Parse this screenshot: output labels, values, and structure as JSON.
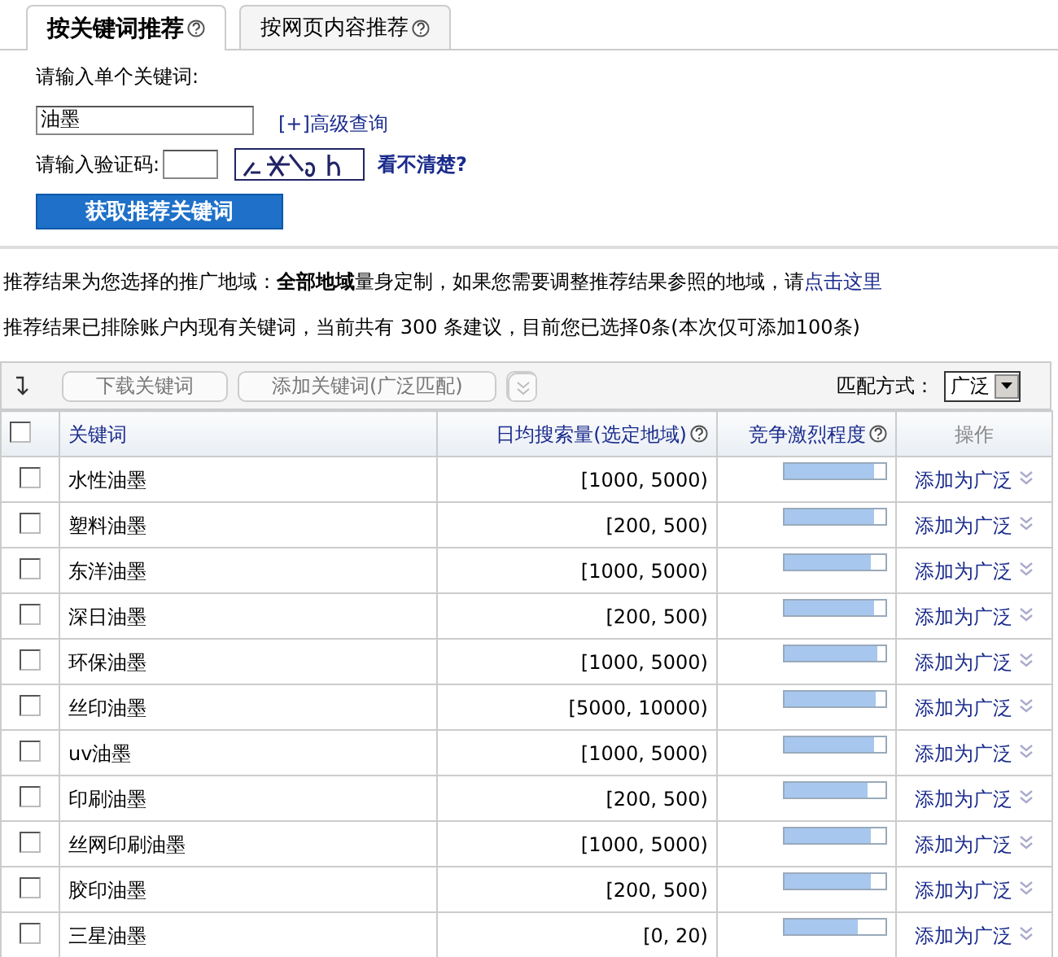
{
  "tabs": [
    {
      "label": "按关键词推荐",
      "selected": true
    },
    {
      "label": "按网页内容推荐",
      "selected": false
    }
  ],
  "form": {
    "keyword_label": "请输入单个关键词:",
    "keyword_value": "油墨",
    "advanced_link": "[+]高级查询",
    "captcha_label": "请输入验证码:",
    "captcha_link": "看不清楚?",
    "submit": "获取推荐关键词"
  },
  "notes": [
    {
      "text": "推荐结果为您选择的推广地域：**全部地域**量身定制，如果您需要调整推荐结果参照的地域，请",
      "link": "点击这里"
    },
    {
      "text": "推荐结果已排除账户内现有关键词，当前共有 300 条建议，目前您已选择0条(本次仅可添加100条)"
    }
  ],
  "toolbar": {
    "buttons": [
      {
        "label": "下载关键词",
        "disabled": true
      },
      {
        "label": "添加关键词(广泛匹配)",
        "disabled": true
      }
    ],
    "match_label": "匹配方式：",
    "match_value": "广泛"
  },
  "table": {
    "all_checked": false,
    "columns": [
      {
        "label": "关键词",
        "help": false
      },
      {
        "label": "日均搜索量(选定地域)",
        "help": true
      },
      {
        "label": "竞争激烈程度",
        "help": true
      },
      {
        "label": "操作",
        "help": false
      }
    ],
    "rows": [
      {
        "keyword": "水性油墨",
        "volume": "[1000, 5000)",
        "level": 0.88,
        "action": "添加为广泛",
        "checked": false
      },
      {
        "keyword": "塑料油墨",
        "volume": "[200, 500)",
        "level": 0.88,
        "action": "添加为广泛",
        "checked": false
      },
      {
        "keyword": "东洋油墨",
        "volume": "[1000, 5000)",
        "level": 0.85,
        "action": "添加为广泛",
        "checked": false
      },
      {
        "keyword": "深日油墨",
        "volume": "[200, 500)",
        "level": 0.88,
        "action": "添加为广泛",
        "checked": false
      },
      {
        "keyword": "环保油墨",
        "volume": "[1000, 5000)",
        "level": 0.92,
        "action": "添加为广泛",
        "checked": false
      },
      {
        "keyword": "丝印油墨",
        "volume": "[5000, 10000)",
        "level": 0.9,
        "action": "添加为广泛",
        "checked": false
      },
      {
        "keyword": "uv油墨",
        "volume": "[1000, 5000)",
        "level": 0.88,
        "action": "添加为广泛",
        "checked": false
      },
      {
        "keyword": "印刷油墨",
        "volume": "[200, 500)",
        "level": 0.82,
        "action": "添加为广泛",
        "checked": false
      },
      {
        "keyword": "丝网印刷油墨",
        "volume": "[1000, 5000)",
        "level": 0.85,
        "action": "添加为广泛",
        "checked": false
      },
      {
        "keyword": "胶印油墨",
        "volume": "[200, 500)",
        "level": 0.85,
        "action": "添加为广泛",
        "checked": false
      },
      {
        "keyword": "三星油墨",
        "volume": "[0, 20)",
        "level": 0.72,
        "action": "添加为广泛",
        "checked": false
      }
    ]
  }
}
